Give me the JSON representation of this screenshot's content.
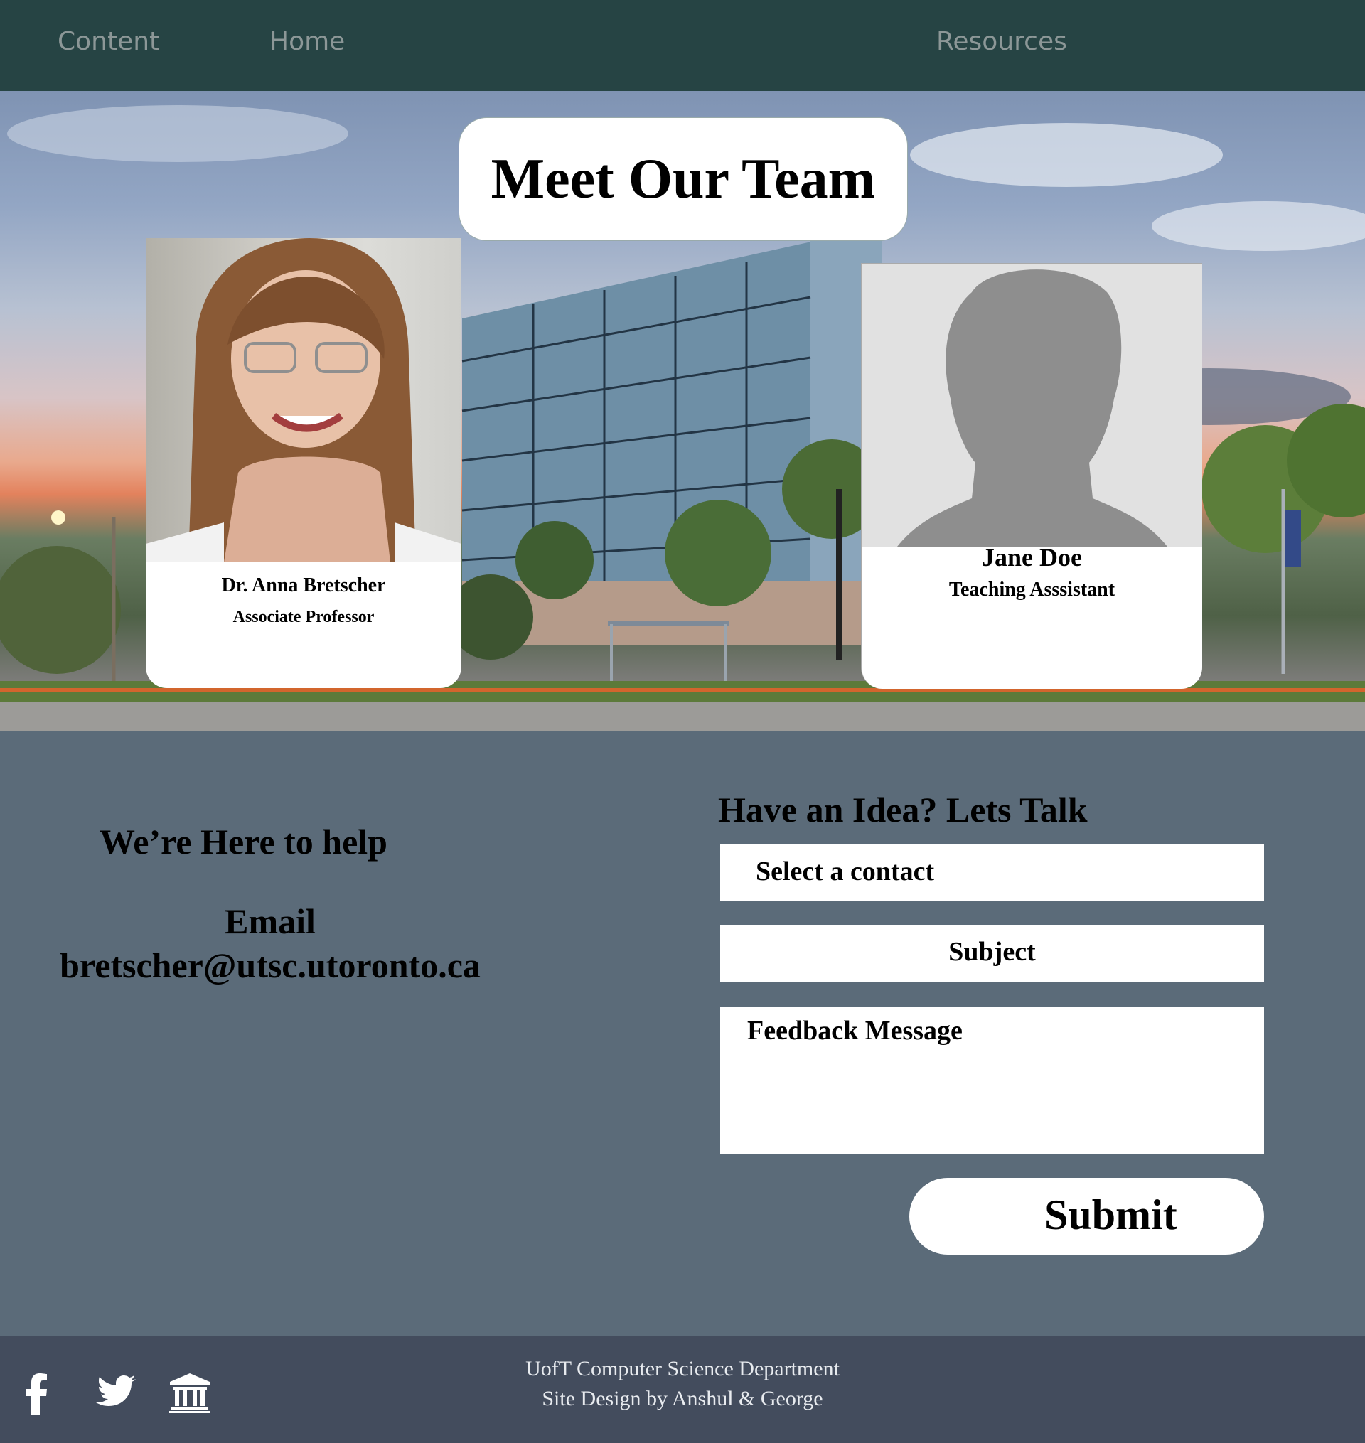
{
  "nav": {
    "items": [
      {
        "label": "Content"
      },
      {
        "label": "Home"
      },
      {
        "label": "Resources"
      }
    ]
  },
  "hero": {
    "title": "Meet Our Team",
    "team": [
      {
        "name": "Dr. Anna Bretscher",
        "role": "Associate Professor"
      },
      {
        "name": "Jane Doe",
        "role": "Teaching Asssistant"
      }
    ]
  },
  "contact": {
    "help_title": "We’re Here to help",
    "email_label": "Email",
    "email_value": "bretscher@utsc.utoronto.ca"
  },
  "form": {
    "title": "Have an Idea? Lets Talk",
    "contact_placeholder": "Select a contact",
    "subject_placeholder": "Subject",
    "message_placeholder": "Feedback Message",
    "submit_label": "Submit"
  },
  "footer": {
    "line1": "UofT Computer Science Department",
    "line2": "Site Design by Anshul & George",
    "icons": [
      "facebook-icon",
      "twitter-icon",
      "university-icon"
    ]
  },
  "colors": {
    "nav_bg": "#264444",
    "body_bg": "#5b6b79",
    "footer_bg": "#434c5d"
  }
}
